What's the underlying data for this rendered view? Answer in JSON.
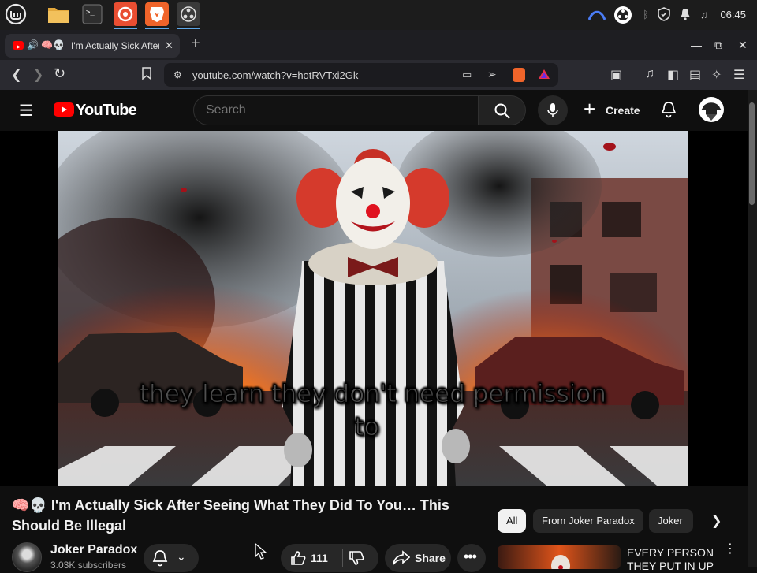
{
  "taskbar": {
    "apps": [
      "mint-menu",
      "files",
      "terminal",
      "firefox",
      "brave",
      "obs"
    ],
    "tray": [
      "vpn-icon",
      "bluetooth-icon",
      "shield-icon",
      "notifications-icon",
      "media-icon"
    ],
    "clock": "06:45"
  },
  "browser": {
    "tab": {
      "emoji": "🧠💀",
      "title": "I'm Actually Sick After Seeing What They Did To You",
      "close": "✕"
    },
    "new_tab": "+",
    "url": "youtube.com/watch?v=hotRVTxi2Gk"
  },
  "youtube": {
    "logo_text": "YouTube",
    "search_placeholder": "Search",
    "create_label": "Create",
    "video": {
      "caption_line1": "they learn they don't need permission",
      "caption_line2": "to",
      "title": "🧠💀 I'm Actually Sick After Seeing What They Did To You… This Should Be Illegal"
    },
    "channel": {
      "name": "Joker Paradox",
      "subscribers": "3.03K subscribers"
    },
    "actions": {
      "likes": "111",
      "share_label": "Share"
    },
    "chips": [
      "All",
      "From Joker Paradox",
      "Joker"
    ],
    "recommendation": {
      "title": "EVERY PERSON THEY PUT IN UP"
    }
  },
  "colors": {
    "brand_red": "#ff0000",
    "background": "#0f0f0f",
    "accent": "#5ea7e8"
  }
}
